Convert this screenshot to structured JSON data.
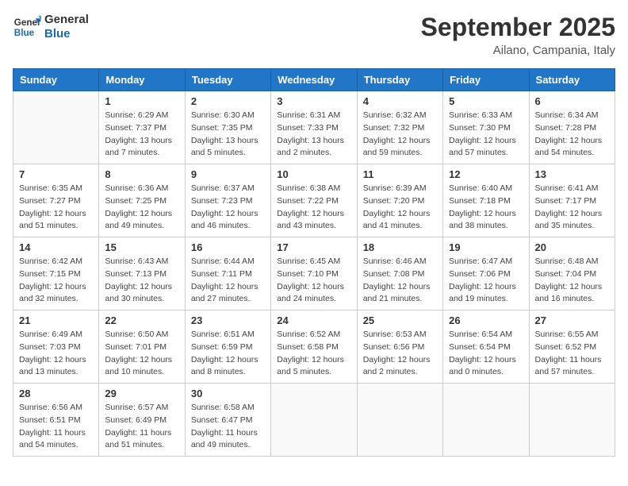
{
  "header": {
    "logo_line1": "General",
    "logo_line2": "Blue",
    "month": "September 2025",
    "location": "Ailano, Campania, Italy"
  },
  "weekdays": [
    "Sunday",
    "Monday",
    "Tuesday",
    "Wednesday",
    "Thursday",
    "Friday",
    "Saturday"
  ],
  "weeks": [
    [
      {
        "day": "",
        "info": ""
      },
      {
        "day": "1",
        "info": "Sunrise: 6:29 AM\nSunset: 7:37 PM\nDaylight: 13 hours\nand 7 minutes."
      },
      {
        "day": "2",
        "info": "Sunrise: 6:30 AM\nSunset: 7:35 PM\nDaylight: 13 hours\nand 5 minutes."
      },
      {
        "day": "3",
        "info": "Sunrise: 6:31 AM\nSunset: 7:33 PM\nDaylight: 13 hours\nand 2 minutes."
      },
      {
        "day": "4",
        "info": "Sunrise: 6:32 AM\nSunset: 7:32 PM\nDaylight: 12 hours\nand 59 minutes."
      },
      {
        "day": "5",
        "info": "Sunrise: 6:33 AM\nSunset: 7:30 PM\nDaylight: 12 hours\nand 57 minutes."
      },
      {
        "day": "6",
        "info": "Sunrise: 6:34 AM\nSunset: 7:28 PM\nDaylight: 12 hours\nand 54 minutes."
      }
    ],
    [
      {
        "day": "7",
        "info": "Sunrise: 6:35 AM\nSunset: 7:27 PM\nDaylight: 12 hours\nand 51 minutes."
      },
      {
        "day": "8",
        "info": "Sunrise: 6:36 AM\nSunset: 7:25 PM\nDaylight: 12 hours\nand 49 minutes."
      },
      {
        "day": "9",
        "info": "Sunrise: 6:37 AM\nSunset: 7:23 PM\nDaylight: 12 hours\nand 46 minutes."
      },
      {
        "day": "10",
        "info": "Sunrise: 6:38 AM\nSunset: 7:22 PM\nDaylight: 12 hours\nand 43 minutes."
      },
      {
        "day": "11",
        "info": "Sunrise: 6:39 AM\nSunset: 7:20 PM\nDaylight: 12 hours\nand 41 minutes."
      },
      {
        "day": "12",
        "info": "Sunrise: 6:40 AM\nSunset: 7:18 PM\nDaylight: 12 hours\nand 38 minutes."
      },
      {
        "day": "13",
        "info": "Sunrise: 6:41 AM\nSunset: 7:17 PM\nDaylight: 12 hours\nand 35 minutes."
      }
    ],
    [
      {
        "day": "14",
        "info": "Sunrise: 6:42 AM\nSunset: 7:15 PM\nDaylight: 12 hours\nand 32 minutes."
      },
      {
        "day": "15",
        "info": "Sunrise: 6:43 AM\nSunset: 7:13 PM\nDaylight: 12 hours\nand 30 minutes."
      },
      {
        "day": "16",
        "info": "Sunrise: 6:44 AM\nSunset: 7:11 PM\nDaylight: 12 hours\nand 27 minutes."
      },
      {
        "day": "17",
        "info": "Sunrise: 6:45 AM\nSunset: 7:10 PM\nDaylight: 12 hours\nand 24 minutes."
      },
      {
        "day": "18",
        "info": "Sunrise: 6:46 AM\nSunset: 7:08 PM\nDaylight: 12 hours\nand 21 minutes."
      },
      {
        "day": "19",
        "info": "Sunrise: 6:47 AM\nSunset: 7:06 PM\nDaylight: 12 hours\nand 19 minutes."
      },
      {
        "day": "20",
        "info": "Sunrise: 6:48 AM\nSunset: 7:04 PM\nDaylight: 12 hours\nand 16 minutes."
      }
    ],
    [
      {
        "day": "21",
        "info": "Sunrise: 6:49 AM\nSunset: 7:03 PM\nDaylight: 12 hours\nand 13 minutes."
      },
      {
        "day": "22",
        "info": "Sunrise: 6:50 AM\nSunset: 7:01 PM\nDaylight: 12 hours\nand 10 minutes."
      },
      {
        "day": "23",
        "info": "Sunrise: 6:51 AM\nSunset: 6:59 PM\nDaylight: 12 hours\nand 8 minutes."
      },
      {
        "day": "24",
        "info": "Sunrise: 6:52 AM\nSunset: 6:58 PM\nDaylight: 12 hours\nand 5 minutes."
      },
      {
        "day": "25",
        "info": "Sunrise: 6:53 AM\nSunset: 6:56 PM\nDaylight: 12 hours\nand 2 minutes."
      },
      {
        "day": "26",
        "info": "Sunrise: 6:54 AM\nSunset: 6:54 PM\nDaylight: 12 hours\nand 0 minutes."
      },
      {
        "day": "27",
        "info": "Sunrise: 6:55 AM\nSunset: 6:52 PM\nDaylight: 11 hours\nand 57 minutes."
      }
    ],
    [
      {
        "day": "28",
        "info": "Sunrise: 6:56 AM\nSunset: 6:51 PM\nDaylight: 11 hours\nand 54 minutes."
      },
      {
        "day": "29",
        "info": "Sunrise: 6:57 AM\nSunset: 6:49 PM\nDaylight: 11 hours\nand 51 minutes."
      },
      {
        "day": "30",
        "info": "Sunrise: 6:58 AM\nSunset: 6:47 PM\nDaylight: 11 hours\nand 49 minutes."
      },
      {
        "day": "",
        "info": ""
      },
      {
        "day": "",
        "info": ""
      },
      {
        "day": "",
        "info": ""
      },
      {
        "day": "",
        "info": ""
      }
    ]
  ]
}
